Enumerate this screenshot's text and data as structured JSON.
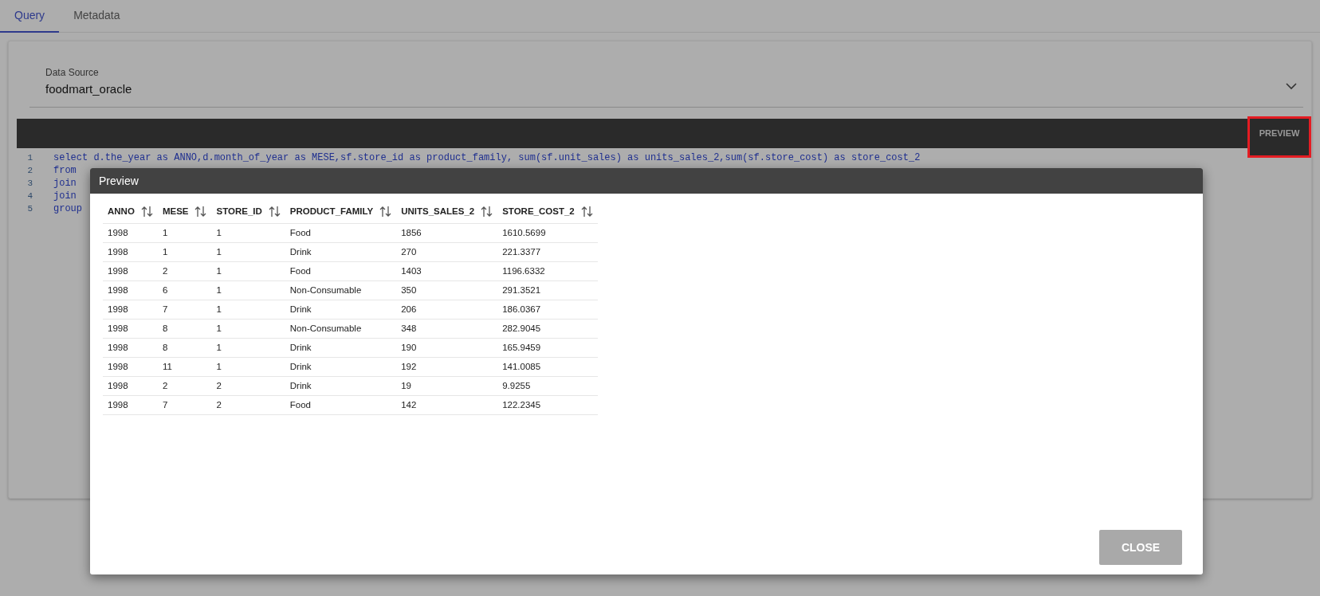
{
  "tabs": [
    {
      "label": "Query",
      "selected": true
    },
    {
      "label": "Metadata",
      "selected": false
    }
  ],
  "data_source": {
    "label": "Data Source",
    "value": "foodmart_oracle"
  },
  "toolbar": {
    "preview_button": "PREVIEW"
  },
  "editor": {
    "lines": [
      {
        "number": "1",
        "code": "select d.the_year as ANNO,d.month_of_year as MESE,sf.store_id as product_family, sum(sf.unit_sales) as units_sales_2,sum(sf.store_cost) as store_cost_2"
      },
      {
        "number": "2",
        "code": "from"
      },
      {
        "number": "3",
        "code": "join"
      },
      {
        "number": "4",
        "code": "join"
      },
      {
        "number": "5",
        "code": "group"
      }
    ]
  },
  "dialog": {
    "title": "Preview",
    "table": {
      "columns": [
        "ANNO",
        "MESE",
        "STORE_ID",
        "PRODUCT_FAMILY",
        "UNITS_SALES_2",
        "STORE_COST_2"
      ],
      "rows": [
        [
          "1998",
          "1",
          "1",
          "Food",
          "1856",
          "1610.5699"
        ],
        [
          "1998",
          "1",
          "1",
          "Drink",
          "270",
          "221.3377"
        ],
        [
          "1998",
          "2",
          "1",
          "Food",
          "1403",
          "1196.6332"
        ],
        [
          "1998",
          "6",
          "1",
          "Non-Consumable",
          "350",
          "291.3521"
        ],
        [
          "1998",
          "7",
          "1",
          "Drink",
          "206",
          "186.0367"
        ],
        [
          "1998",
          "8",
          "1",
          "Non-Consumable",
          "348",
          "282.9045"
        ],
        [
          "1998",
          "8",
          "1",
          "Drink",
          "190",
          "165.9459"
        ],
        [
          "1998",
          "11",
          "1",
          "Drink",
          "192",
          "141.0085"
        ],
        [
          "1998",
          "2",
          "2",
          "Drink",
          "19",
          "9.9255"
        ],
        [
          "1998",
          "7",
          "2",
          "Food",
          "142",
          "122.2345"
        ]
      ]
    },
    "close_button": "CLOSE"
  }
}
